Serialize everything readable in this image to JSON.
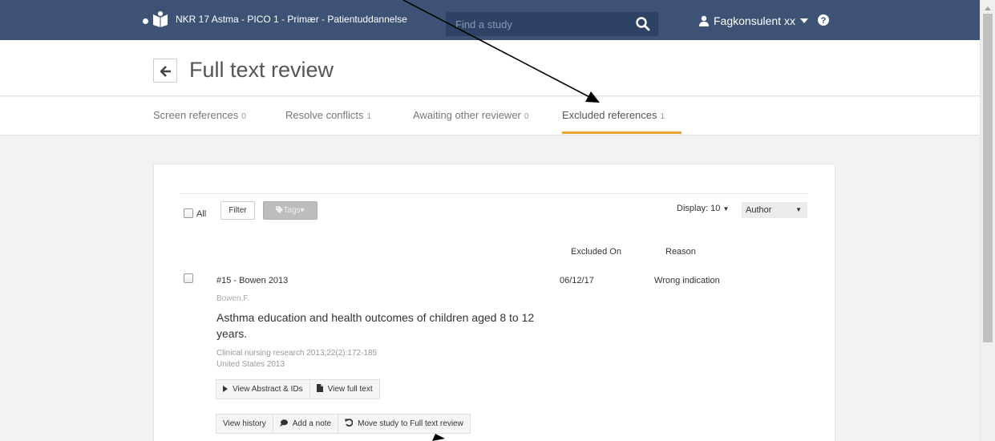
{
  "topbar": {
    "project": "NKR 17 Astma - PICO 1 - Primær - Patientuddannelse",
    "search_placeholder": "Find a study",
    "user": "Fagkonsulent xx"
  },
  "header": {
    "title": "Full text review"
  },
  "tabs": [
    {
      "label": "Screen references",
      "count": "0"
    },
    {
      "label": "Resolve conflicts",
      "count": "1"
    },
    {
      "label": "Awaiting other reviewer",
      "count": "0"
    },
    {
      "label": "Excluded references",
      "count": "1",
      "active": true
    }
  ],
  "toolbar": {
    "all_label": "All",
    "filter_label": "Filter",
    "tags_label": "Tags",
    "display_label": "Display: 10",
    "sort_value": "Author"
  },
  "columns": {
    "excluded_on": "Excluded On",
    "reason": "Reason"
  },
  "reference": {
    "id": "#15 - Bowen 2013",
    "authors": "Bowen,F.",
    "title": "Asthma education and health outcomes of children aged 8 to 12 years.",
    "journal": "Clinical nursing research 2013;22(2):172-185",
    "country_year": "United States 2013",
    "excluded_on": "06/12/17",
    "reason": "Wrong indication"
  },
  "actions": {
    "view_abstract": "View Abstract & IDs",
    "view_full_text": "View full text",
    "view_history": "View history",
    "add_note": "Add a note",
    "move_study": "Move study to Full text review"
  },
  "colors": {
    "navbar": "#3d5275",
    "tab_underline": "#f0a030"
  }
}
